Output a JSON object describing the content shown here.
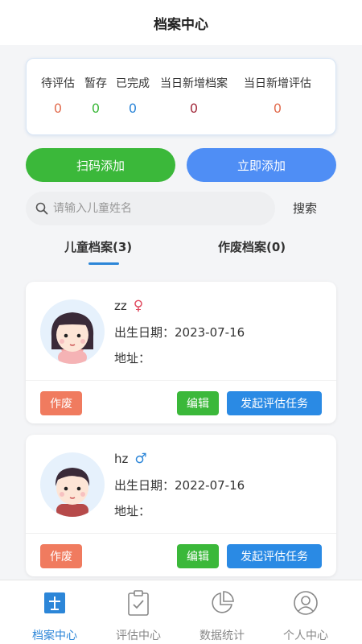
{
  "header": {
    "title": "档案中心"
  },
  "stats": [
    {
      "label": "待评估",
      "value": "0",
      "color": "#e26d4f"
    },
    {
      "label": "暂存",
      "value": "0",
      "color": "#3bb83a"
    },
    {
      "label": "已完成",
      "value": "0",
      "color": "#2c86d8"
    },
    {
      "label": "当日新增档案",
      "value": "0",
      "color": "#a22a3c"
    },
    {
      "label": "当日新增评估",
      "value": "0",
      "color": "#e26d4f"
    }
  ],
  "actions": {
    "scan_add": "扫码添加",
    "add_now": "立即添加"
  },
  "search": {
    "placeholder": "请输入儿童姓名",
    "button": "搜索"
  },
  "tabs": [
    {
      "label": "儿童档案(3)",
      "active": true
    },
    {
      "label": "作废档案(0)",
      "active": false
    }
  ],
  "children": [
    {
      "name": "zz",
      "gender_symbol": "♀",
      "gender_color": "#e04a5f",
      "birth": "出生日期：2023-07-16",
      "address": "地址："
    },
    {
      "name": "hz",
      "gender_symbol": "♂",
      "gender_color": "#2c86d8",
      "birth": "出生日期：2022-07-16",
      "address": "地址："
    }
  ],
  "card_buttons": {
    "void": "作废",
    "edit": "编辑",
    "task": "发起评估任务"
  },
  "tabbar": [
    {
      "label": "档案中心",
      "icon": "archive-icon",
      "active": true
    },
    {
      "label": "评估中心",
      "icon": "clipboard-check-icon",
      "active": false
    },
    {
      "label": "数据统计",
      "icon": "pie-chart-icon",
      "active": false
    },
    {
      "label": "个人中心",
      "icon": "user-icon",
      "active": false
    }
  ],
  "colors": {
    "primary": "#2c86d8",
    "green": "#3bb83a",
    "blue": "#4f8ef5",
    "red": "#f07b5f"
  }
}
